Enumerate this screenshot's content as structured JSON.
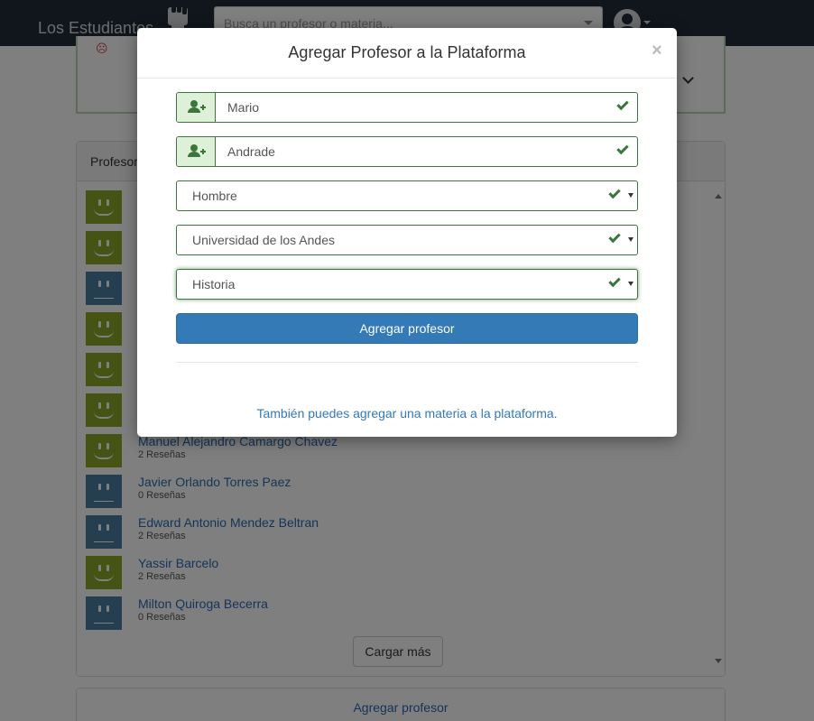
{
  "navbar": {
    "brand": "Los Estudiantes",
    "search_placeholder": "Busca un profesor o materia..."
  },
  "colors": {
    "navbar": "#222d3b",
    "face_green": "#8aa82b",
    "face_blue": "#4a7ea3",
    "success": "#3c763d",
    "primary": "#337ab7",
    "link": "#2a6bb0"
  },
  "list_panel": {
    "title": "Profesores",
    "items": [
      {
        "name": "",
        "reviews": "",
        "mood": "happy"
      },
      {
        "name": "",
        "reviews": "",
        "mood": "happy"
      },
      {
        "name": "",
        "reviews": "",
        "mood": "neutral"
      },
      {
        "name": "",
        "reviews": "",
        "mood": "happy"
      },
      {
        "name": "",
        "reviews": "",
        "mood": "happy"
      },
      {
        "name": "",
        "reviews": "",
        "mood": "happy"
      },
      {
        "name": "Manuel Alejandro Camargo Chavez",
        "reviews": "2 Reseñas",
        "mood": "happy"
      },
      {
        "name": "Javier Orlando Torres Paez",
        "reviews": "0 Reseñas",
        "mood": "neutral"
      },
      {
        "name": "Edward Antonio Mendez Beltran",
        "reviews": "2 Reseñas",
        "mood": "neutral"
      },
      {
        "name": "Yassir Barcelo",
        "reviews": "2 Reseñas",
        "mood": "happy"
      },
      {
        "name": "Milton Quiroga Becerra",
        "reviews": "0 Reseñas",
        "mood": "neutral"
      }
    ],
    "load_more": "Cargar más"
  },
  "bottom_panel": {
    "link": "Agregar profesor"
  },
  "modal": {
    "title": "Agregar Profesor a la Plataforma",
    "close": "×",
    "first_name": "Mario",
    "last_name": "Andrade",
    "gender": "Hombre",
    "university": "Universidad de los Andes",
    "department": "Historia",
    "submit": "Agregar profesor",
    "footer_link": "También puedes agregar una materia a la plataforma."
  }
}
